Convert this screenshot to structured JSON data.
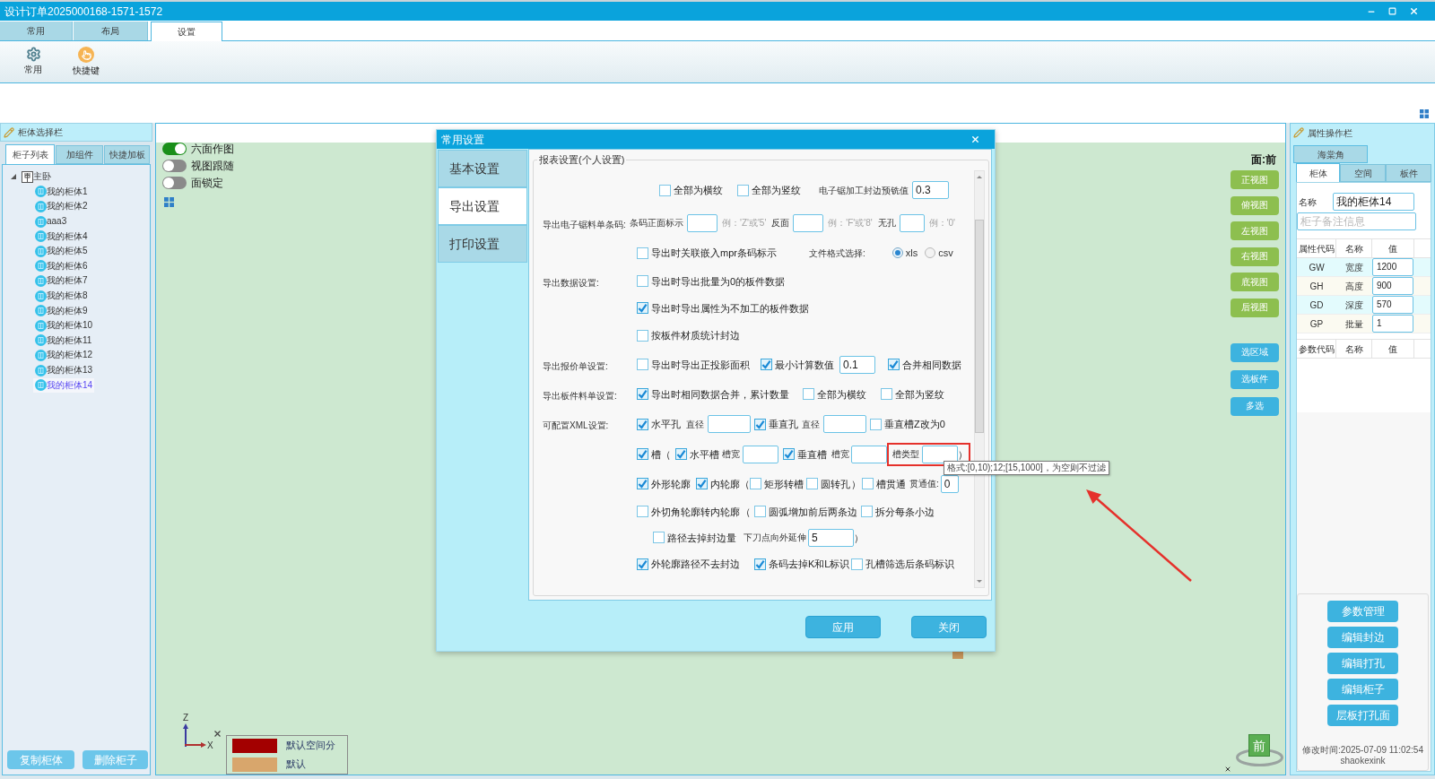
{
  "window": {
    "title": "设计订单2025000168-1571-1572"
  },
  "ribbon": {
    "tabs": [
      {
        "label": "常用",
        "selected": false
      },
      {
        "label": "布局",
        "selected": false
      },
      {
        "label": "设置",
        "selected": true
      }
    ],
    "tools": [
      {
        "kind": "gear",
        "label": "常用"
      },
      {
        "kind": "hand",
        "label": "快捷键"
      }
    ]
  },
  "left_panel": {
    "title": "柜体选择栏",
    "tabs": [
      {
        "label": "柜子列表",
        "selected": true
      },
      {
        "label": "加组件",
        "selected": false
      },
      {
        "label": "快捷加板",
        "selected": false
      }
    ],
    "tree": [
      {
        "label": "主卧",
        "selected": false,
        "expanded": true,
        "children": [
          {
            "label": "我的柜体1",
            "selected": false
          },
          {
            "label": "我的柜体2",
            "selected": false
          },
          {
            "label": "aaa3",
            "selected": false
          },
          {
            "label": "我的柜体4",
            "selected": false
          },
          {
            "label": "我的柜体5",
            "selected": false
          },
          {
            "label": "我的柜体6",
            "selected": false
          },
          {
            "label": "我的柜体7",
            "selected": false
          },
          {
            "label": "我的柜体8",
            "selected": false
          },
          {
            "label": "我的柜体9",
            "selected": false
          },
          {
            "label": "我的柜体10",
            "selected": false
          },
          {
            "label": "我的柜体11",
            "selected": false
          },
          {
            "label": "我的柜体12",
            "selected": false
          },
          {
            "label": "我的柜体13",
            "selected": false
          },
          {
            "label": "我的柜体14",
            "selected": true
          }
        ]
      }
    ],
    "buttons": [
      "复制柜体",
      "删除柜子"
    ]
  },
  "canvas": {
    "toggles": [
      {
        "label": "六面作图",
        "on": true
      },
      {
        "label": "视图跟随",
        "on": false
      },
      {
        "label": "面锁定",
        "on": false
      }
    ],
    "face_label": "面:前",
    "view_buttons": [
      "正视图",
      "俯视图",
      "左视图",
      "右视图",
      "底视图",
      "后视图"
    ],
    "select_buttons": [
      "选区域",
      "选板件",
      "多选"
    ],
    "axes": {
      "vertical": "Z",
      "horizontal": "X"
    },
    "legend": [
      {
        "label": "默认空间分",
        "color": "#a30000"
      },
      {
        "label": "默认",
        "color": "#d8a66c"
      }
    ],
    "view_cube": "前"
  },
  "dialog": {
    "title": "常用设置",
    "nav": [
      {
        "label": "基本设置",
        "selected": false
      },
      {
        "label": "导出设置",
        "selected": true
      },
      {
        "label": "打印设置",
        "selected": false
      }
    ],
    "group_title": "报表设置(个人设置)",
    "rows": [
      {
        "items": [
          {
            "kind": "checkbox",
            "label": "全部为横纹",
            "checked": false
          },
          {
            "kind": "checkbox",
            "label": "全部为竖纹",
            "checked": false
          },
          {
            "kind": "label",
            "text": "电子锯加工封边预铣值"
          },
          {
            "kind": "input",
            "value": "0.3"
          }
        ]
      },
      {
        "label": "导出电子锯料单条码:",
        "items": [
          {
            "kind": "label",
            "text": "条码正面标示"
          },
          {
            "kind": "input"
          },
          {
            "kind": "hint",
            "text": "例：'Z'或'5'"
          },
          {
            "kind": "label",
            "text": "反面"
          },
          {
            "kind": "input"
          },
          {
            "kind": "hint",
            "text": "例：'F'或'8'"
          },
          {
            "kind": "label",
            "text": "无孔"
          },
          {
            "kind": "input"
          },
          {
            "kind": "hint",
            "text": "例：'0'"
          }
        ]
      },
      {
        "items": [
          {
            "kind": "checkbox",
            "label": "导出时关联嵌入mpr条码标示",
            "checked": false
          },
          {
            "kind": "label",
            "text": "文件格式选择:"
          },
          {
            "kind": "radio",
            "label": "xls",
            "selected": true
          },
          {
            "kind": "radio",
            "label": "csv",
            "selected": false
          }
        ]
      },
      {
        "label": "导出数据设置:",
        "items": [
          {
            "kind": "checkbox",
            "label": "导出时导出批量为0的板件数据",
            "checked": false
          }
        ]
      },
      {
        "items": [
          {
            "kind": "checkbox",
            "label": "导出时导出属性为不加工的板件数据",
            "checked": true
          }
        ]
      },
      {
        "items": [
          {
            "kind": "checkbox",
            "label": "按板件材质统计封边",
            "checked": false
          }
        ]
      },
      {
        "label": "导出报价单设置:",
        "items": [
          {
            "kind": "checkbox",
            "label": "导出时导出正投影面积",
            "checked": false
          },
          {
            "kind": "checkbox",
            "label": "最小计算数值",
            "checked": true
          },
          {
            "kind": "input",
            "value": "0.1"
          },
          {
            "kind": "checkbox",
            "label": "合并相同数据",
            "checked": true
          }
        ]
      },
      {
        "label": "导出板件料单设置:",
        "items": [
          {
            "kind": "checkbox",
            "label": "导出时相同数据合并，累计数量",
            "checked": true
          },
          {
            "kind": "checkbox",
            "label": "全部为横纹",
            "checked": false
          },
          {
            "kind": "checkbox",
            "label": "全部为竖纹",
            "checked": false
          }
        ]
      },
      {
        "label": "可配置XML设置:",
        "items": [
          {
            "kind": "checkbox",
            "label": "水平孔",
            "checked": true
          },
          {
            "kind": "label",
            "text": "直径"
          },
          {
            "kind": "input"
          },
          {
            "kind": "checkbox",
            "label": "垂直孔",
            "checked": true
          },
          {
            "kind": "label",
            "text": "直径"
          },
          {
            "kind": "input"
          },
          {
            "kind": "checkbox",
            "label": "垂直槽Z改为0",
            "checked": false
          }
        ]
      },
      {
        "items": [
          {
            "kind": "checkbox",
            "label": "槽",
            "checked": true
          },
          {
            "kind": "paren",
            "text": "（"
          },
          {
            "kind": "checkbox",
            "label": "水平槽",
            "checked": true
          },
          {
            "kind": "label",
            "text": "槽宽"
          },
          {
            "kind": "input"
          },
          {
            "kind": "checkbox",
            "label": "垂直槽",
            "checked": true
          },
          {
            "kind": "label",
            "text": "槽宽"
          },
          {
            "kind": "input"
          },
          {
            "kind": "highlight",
            "tooltip": "格式:[0,10);12;[15,1000]，为空则不过滤",
            "items": [
              {
                "kind": "label",
                "text": "槽类型"
              },
              {
                "kind": "input"
              },
              {
                "kind": "paren",
                "text": "）"
              }
            ]
          }
        ]
      },
      {
        "items": [
          {
            "kind": "checkbox",
            "label": "外形轮廓",
            "checked": true
          },
          {
            "kind": "checkbox",
            "label": "内轮廓",
            "checked": true
          },
          {
            "kind": "paren",
            "text": "（"
          },
          {
            "kind": "checkbox",
            "label": "矩形转槽",
            "checked": false
          },
          {
            "kind": "checkbox",
            "label": "圆转孔",
            "checked": false
          },
          {
            "kind": "paren",
            "text": "）"
          },
          {
            "kind": "checkbox",
            "label": "槽贯通",
            "checked": false
          },
          {
            "kind": "label",
            "text": "贯通值:"
          },
          {
            "kind": "input",
            "value": "0"
          }
        ]
      },
      {
        "items": [
          {
            "kind": "checkbox",
            "label": "外切角轮廓转内轮廓",
            "checked": false
          },
          {
            "kind": "paren",
            "text": "（"
          },
          {
            "kind": "checkbox",
            "label": "圆弧增加前后两条边",
            "checked": false
          },
          {
            "kind": "checkbox",
            "label": "拆分每条小边",
            "checked": false
          }
        ]
      },
      {
        "items": [
          {
            "kind": "checkbox",
            "label": "路径去掉封边量",
            "checked": false
          },
          {
            "kind": "label",
            "text": "下刀点向外延伸"
          },
          {
            "kind": "input",
            "value": "5"
          },
          {
            "kind": "paren",
            "text": "）"
          }
        ]
      },
      {
        "items": [
          {
            "kind": "checkbox",
            "label": "外轮廓路径不去封边",
            "checked": true
          },
          {
            "kind": "checkbox",
            "label": "条码去掉K和L标识",
            "checked": true
          },
          {
            "kind": "checkbox",
            "label": "孔槽筛选后条码标识",
            "checked": false
          }
        ]
      }
    ],
    "buttons": [
      "应用",
      "关闭"
    ]
  },
  "right_panel": {
    "title": "属性操作栏",
    "top_tabs": [
      {
        "label": "海棠角",
        "selected": false
      }
    ],
    "tabs": [
      {
        "label": "柜体",
        "selected": true
      },
      {
        "label": "空间",
        "selected": false
      },
      {
        "label": "板件",
        "selected": false
      }
    ],
    "name_label": "名称",
    "name_value": "我的柜体14",
    "remark_placeholder": "柜子备注信息",
    "attributes": {
      "columns": [
        "属性代码",
        "名称",
        "值"
      ],
      "rows": [
        {
          "code": "GW",
          "name": "宽度",
          "value": "1200"
        },
        {
          "code": "GH",
          "name": "高度",
          "value": "900"
        },
        {
          "code": "GD",
          "name": "深度",
          "value": "570"
        },
        {
          "code": "GP",
          "name": "批量",
          "value": "1"
        }
      ]
    },
    "parameters": {
      "columns": [
        "参数代码",
        "名称",
        "值"
      ]
    },
    "buttons": [
      "参数管理",
      "编辑封边",
      "编辑打孔",
      "编辑柜子",
      "层板打孔面"
    ],
    "footer": "修改时间:2025-07-09 11:02:54 shaokexink"
  }
}
